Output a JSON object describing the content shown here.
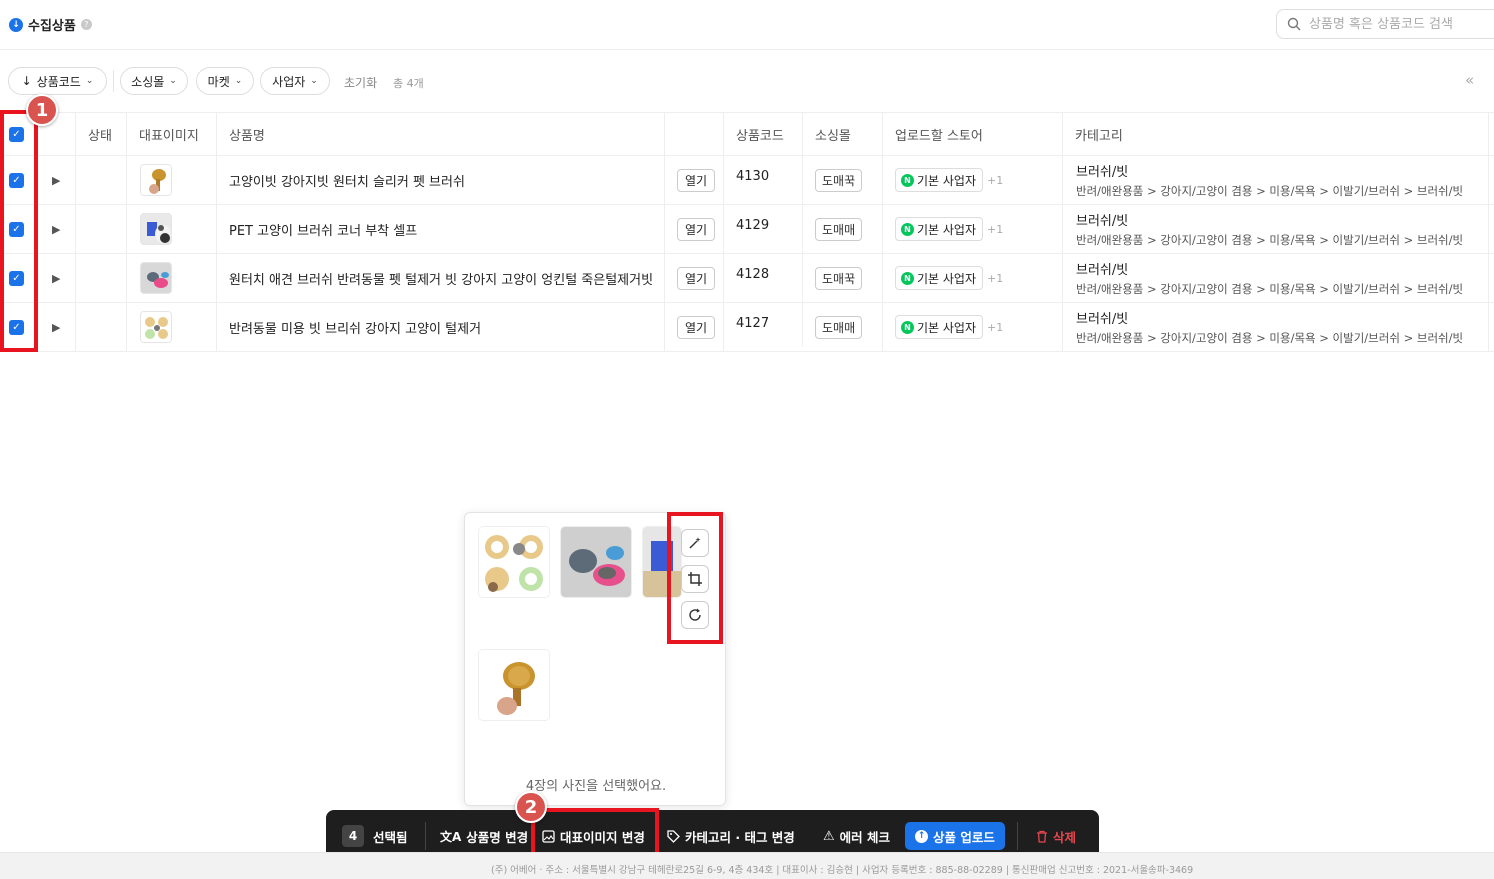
{
  "header": {
    "title": "수집상품",
    "search_placeholder": "상품명 혹은 상품코드 검색"
  },
  "filters": {
    "sort_label": "상품코드",
    "chips": [
      "소싱몰",
      "마켓",
      "사업자"
    ],
    "reset_label": "초기화",
    "total_label": "총 4개",
    "collapse_symbol": "«"
  },
  "table": {
    "columns": [
      "상태",
      "대표이미지",
      "상품명",
      "",
      "상품코드",
      "소싱몰",
      "업로드할 스토어",
      "카테고리"
    ],
    "open_label": "열기",
    "rows": [
      {
        "name": "고양이빗 강아지빗 원터치 슬리커 펫 브러쉬",
        "code": "4130",
        "mall": "도매꾹",
        "store": "기본 사업자",
        "store_extra": "+1",
        "category": "브러쉬/빗",
        "category_path": "반려/애완용품 > 강아지/고양이 겸용 > 미용/목욕 > 이발기/브러쉬 > 브러쉬/빗",
        "selected": true
      },
      {
        "name": "PET 고양이 브러쉬 코너 부착 셀프",
        "code": "4129",
        "mall": "도매매",
        "store": "기본 사업자",
        "store_extra": "+1",
        "category": "브러쉬/빗",
        "category_path": "반려/애완용품 > 강아지/고양이 겸용 > 미용/목욕 > 이발기/브러쉬 > 브러쉬/빗",
        "selected": true
      },
      {
        "name": "원터치 애견 브러쉬 반려동물 펫 털제거 빗 강아지 고양이 엉킨털 죽은털제거빗",
        "code": "4128",
        "mall": "도매꾹",
        "store": "기본 사업자",
        "store_extra": "+1",
        "category": "브러쉬/빗",
        "category_path": "반려/애완용품 > 강아지/고양이 겸용 > 미용/목욕 > 이발기/브러쉬 > 브러쉬/빗",
        "selected": true
      },
      {
        "name": "반려동물 미용 빗 브리쉬 강아지 고양이 털제거",
        "code": "4127",
        "mall": "도매매",
        "store": "기본 사업자",
        "store_extra": "+1",
        "category": "브러쉬/빗",
        "category_path": "반려/애완용품 > 강아지/고양이 겸용 > 미용/목욕 > 이발기/브러쉬 > 브러쉬/빗",
        "selected": true
      }
    ]
  },
  "annotations": {
    "badge1": "1",
    "badge2": "2"
  },
  "popup": {
    "caption": "4장의 사진을 선택했어요.",
    "tools": [
      "magic-wand-icon",
      "crop-icon",
      "rotate-icon"
    ]
  },
  "actionbar": {
    "selected_count": "4",
    "selected_label": "선택됨",
    "rename_label": "상품명 변경",
    "image_change_label": "대표이미지 변경",
    "category_tag_label": "카테고리 · 태그 변경",
    "error_check_label": "에러 체크",
    "upload_label": "상품 업로드",
    "delete_label": "삭제"
  },
  "footer": {
    "text": "(주) 어베어 · 주소 : 서울특별시 강남구 테헤란로25길 6-9, 4층 434호 | 대표이사 : 김승현 | 사업자 등록번호 : 885-88-02289 | 통신판매업 신고번호 : 2021-서울송파-3469"
  },
  "colors": {
    "accent": "#1a73e8",
    "highlight": "#e8141f",
    "naver": "#03c75a",
    "delete": "#e8474f",
    "actionbar_bg": "#1e1e1e"
  }
}
